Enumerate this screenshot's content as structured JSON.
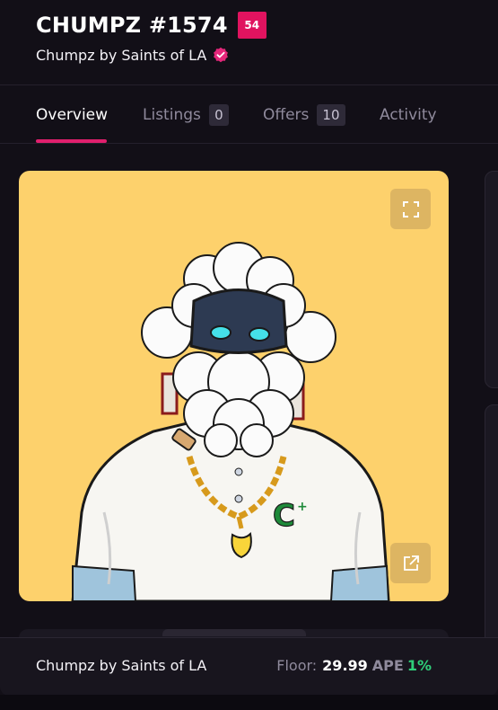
{
  "header": {
    "title": "CHUMPZ #1574",
    "rank_badge": "54",
    "collection_name": "Chumpz by Saints of LA",
    "verified_icon": "verified-check-icon"
  },
  "tabs": [
    {
      "label": "Overview",
      "count": null,
      "active": true
    },
    {
      "label": "Listings",
      "count": "0",
      "active": false
    },
    {
      "label": "Offers",
      "count": "10",
      "active": false
    },
    {
      "label": "Activity",
      "count": null,
      "active": false
    }
  ],
  "media": {
    "background_color": "#fdd16c",
    "expand_icon": "expand-icon",
    "external_icon": "external-link-icon"
  },
  "bottom_bar": {
    "collection_name": "Chumpz by Saints of LA",
    "floor_label": "Floor:",
    "floor_value": "29.99",
    "floor_currency": "APE",
    "floor_change": "1%"
  },
  "colors": {
    "accent": "#e01f6d",
    "badge": "#e0135f",
    "positive": "#2fcf7a",
    "background": "#120f17"
  }
}
